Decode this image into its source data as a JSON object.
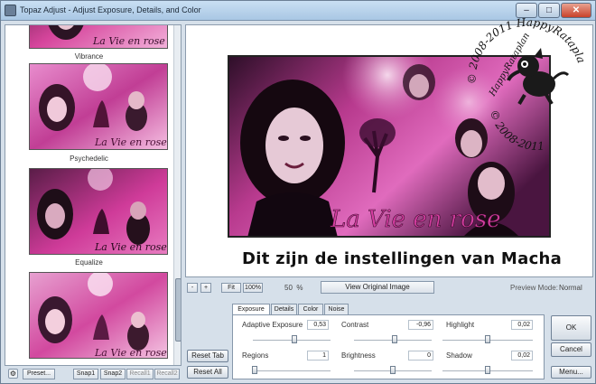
{
  "window": {
    "title": "Topaz Adjust - Adjust Exposure, Details, and Color",
    "minimize_glyph": "–",
    "maximize_glyph": "□",
    "close_glyph": "✕"
  },
  "presets": {
    "items": [
      {
        "label": "Vibrance"
      },
      {
        "label": "Psychedelic"
      },
      {
        "label": "Equalize"
      },
      {
        "label": ""
      }
    ],
    "image_overlay_text": "La Vie en rose"
  },
  "bottom_left": {
    "buttons": [
      {
        "label": "Preset...",
        "enabled": true
      },
      {
        "label": "Snap1",
        "enabled": true
      },
      {
        "label": "Snap2",
        "enabled": true
      },
      {
        "label": "Recall1",
        "enabled": false
      },
      {
        "label": "Recall2",
        "enabled": false
      }
    ],
    "settings_icon": "gear-icon"
  },
  "preview": {
    "image_overlay_text": "La Vie en rose",
    "caption": "Dit zijn de instellingen van Macha",
    "watermark": {
      "line1": "© 2008-2011 HappyRataplan",
      "line2": "© 2008-2011",
      "line3": "HappyRataplan"
    }
  },
  "zoombar": {
    "minus": "-",
    "plus": "+",
    "fit": "Fit",
    "hundred": "100%",
    "zoom": "50",
    "zoom_unit": "%",
    "original_button": "View Original Image",
    "preview_mode_label": "Preview Mode:",
    "preview_mode_value": "Normal"
  },
  "tabs": [
    "Exposure",
    "Details",
    "Color",
    "Noise"
  ],
  "active_tab": "Exposure",
  "controls": {
    "adaptive_exposure": {
      "label": "Adaptive Exposure",
      "value": "0,53",
      "level": 0.53
    },
    "contrast": {
      "label": "Contrast",
      "value": "-0,96",
      "level": 0.52
    },
    "highlight": {
      "label": "Highlight",
      "value": "0,02",
      "level": 0.5
    },
    "regions": {
      "label": "Regions",
      "value": "1",
      "level": 0.02
    },
    "brightness": {
      "label": "Brightness",
      "value": "0",
      "level": 0.5
    },
    "shadow": {
      "label": "Shadow",
      "value": "0,02",
      "level": 0.5
    }
  },
  "reset": {
    "tab": "Reset Tab",
    "all": "Reset All"
  },
  "right_buttons": {
    "ok": "OK",
    "cancel": "Cancel",
    "menu": "Menu..."
  },
  "colors": {
    "magenta": "#c8328c",
    "pink": "#f07cc4",
    "dark": "#2a1326"
  }
}
